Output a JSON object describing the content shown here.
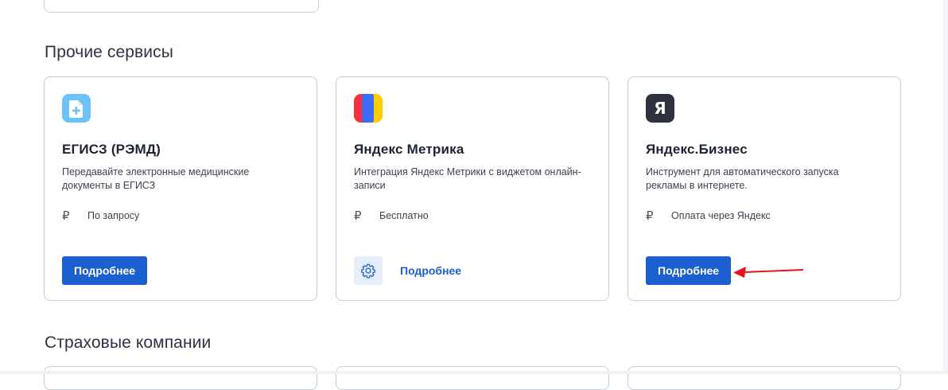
{
  "sections": {
    "other_services_title": "Прочие сервисы",
    "insurance_title": "Страховые компании"
  },
  "cards": [
    {
      "title": "ЕГИСЗ (РЭМД)",
      "description": "Передавайте электронные медицинские документы в ЕГИСЗ",
      "currency_symbol": "₽",
      "price": "По запросу",
      "button_label": "Подробнее",
      "icon": "document-plus-icon",
      "icon_color": "#6cc3f5"
    },
    {
      "title": "Яндекс Метрика",
      "description": "Интеграция Яндекс Метрики с виджетом онлайн-записи",
      "currency_symbol": "₽",
      "price": "Бесплатно",
      "button_label": "Подробнее",
      "icon": "yandex-metrika-icon"
    },
    {
      "title": "Яндекс.Бизнес",
      "description": "Инструмент для автоматического запуска рекламы в интернете.",
      "currency_symbol": "₽",
      "price": "Оплата через Яндекс",
      "button_label": "Подробнее",
      "icon": "yandex-ya-icon",
      "icon_letter": "Я",
      "icon_color": "#2e3240"
    }
  ],
  "colors": {
    "primary": "#1b5fd1",
    "card_border": "#c2ccda",
    "annotation_arrow": "#e8141b"
  }
}
